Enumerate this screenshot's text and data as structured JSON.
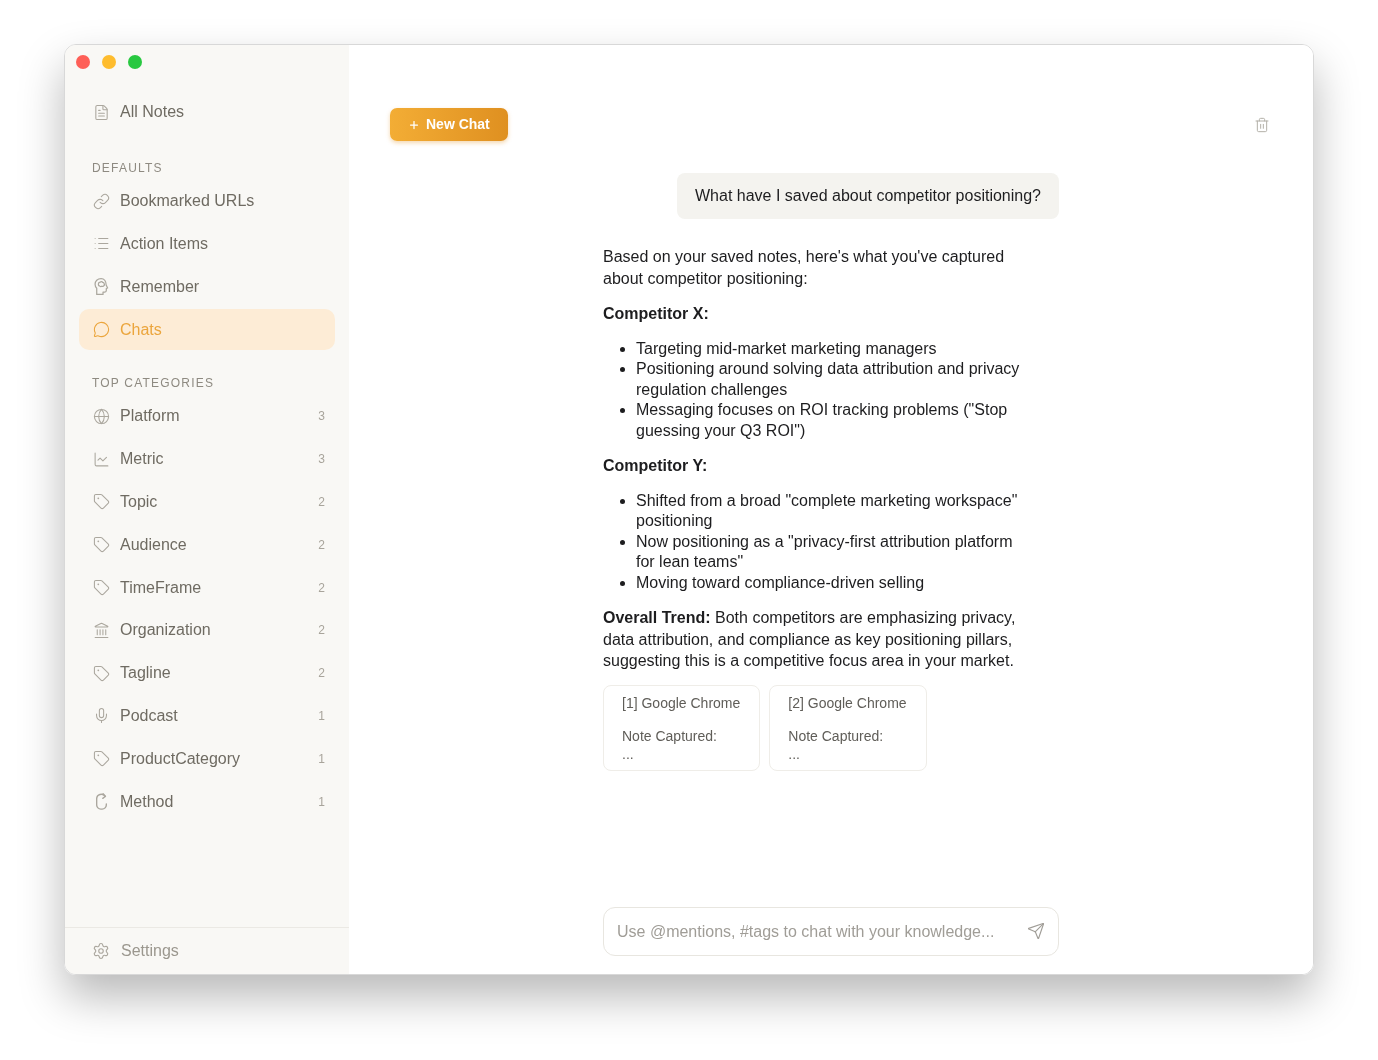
{
  "sidebar": {
    "top_items": [
      {
        "label": "All Notes",
        "selected": false
      }
    ],
    "sections": [
      {
        "title": "DEFAULTS",
        "items": [
          {
            "label": "Bookmarked URLs",
            "selected": false
          },
          {
            "label": "Action Items",
            "selected": false
          },
          {
            "label": "Remember",
            "selected": false
          },
          {
            "label": "Chats",
            "selected": true
          }
        ]
      },
      {
        "title": "TOP CATEGORIES",
        "items": [
          {
            "label": "Platform",
            "count": "3",
            "selected": false
          },
          {
            "label": "Metric",
            "count": "3",
            "selected": false
          },
          {
            "label": "Topic",
            "count": "2",
            "selected": false
          },
          {
            "label": "Audience",
            "count": "2",
            "selected": false
          },
          {
            "label": "TimeFrame",
            "count": "2",
            "selected": false
          },
          {
            "label": "Organization",
            "count": "2",
            "selected": false
          },
          {
            "label": "Tagline",
            "count": "2",
            "selected": false
          },
          {
            "label": "Podcast",
            "count": "1",
            "selected": false
          },
          {
            "label": "ProductCategory",
            "count": "1",
            "selected": false
          },
          {
            "label": "Method",
            "count": "1",
            "selected": false
          }
        ]
      }
    ],
    "footer": {
      "settings_label": "Settings"
    }
  },
  "toolbar": {
    "new_chat_label": "New Chat"
  },
  "chat": {
    "user_message": {
      "text": "What have I saved about competitor positioning?"
    },
    "assistant_reply": {
      "blocks": [
        {
          "kind": "paragraph",
          "text": "Based on your saved notes, here's what you've captured about competitor positioning:"
        },
        {
          "kind": "heading",
          "text": "Competitor X:"
        },
        {
          "kind": "bullets",
          "items": [
            "Targeting mid-market marketing managers",
            "Positioning around solving data attribution and privacy regulation challenges",
            "Messaging focuses on ROI tracking problems (\"Stop guessing your Q3 ROI\")"
          ]
        },
        {
          "kind": "heading",
          "text": "Competitor Y:"
        },
        {
          "kind": "bullets",
          "items": [
            "Shifted from a broad \"complete marketing workspace\" positioning",
            "Now positioning as a \"privacy-first attribution platform for lean teams\"",
            "Moving toward compliance-driven selling"
          ]
        },
        {
          "kind": "paragraph",
          "text": "**Overall Trend:** Both competitors are emphasizing privacy, data attribution, and compliance as key positioning pillars, suggesting this is a competitive focus area in your market."
        }
      ],
      "sources": [
        {
          "title": "[1] Google Chrome",
          "label": "Note Captured:",
          "excerpt": "..."
        },
        {
          "title": "[2] Google Chrome",
          "label": "Note Captured:",
          "excerpt": "..."
        }
      ]
    }
  },
  "composer": {
    "placeholder": "Use @mentions, #tags to chat with your knowledge..."
  }
}
